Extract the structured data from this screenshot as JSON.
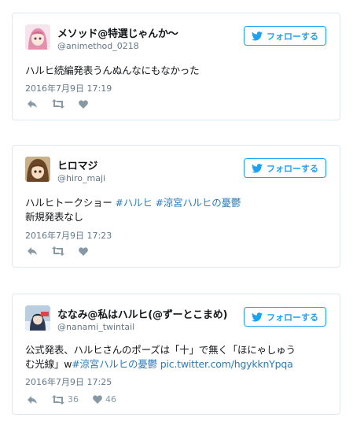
{
  "follow_label": "フォローする",
  "tweets": [
    {
      "name": "メソッド@特選じゃんか〜",
      "handle": "@animethod_0218",
      "text": "ハルヒ続編発表うんぬんなにもなかった",
      "date": "2016年7月9日 17:19"
    },
    {
      "name": "ヒロマジ",
      "handle": "@hiro_maji",
      "text_plain": "ハルヒトークショー ",
      "hashtag1": "#ハルヒ",
      "hashtag2": "#涼宮ハルヒの憂鬱",
      "text_line2": "新規発表なし",
      "date": "2016年7月9日 17:23"
    },
    {
      "name": "ななみ@私はハルヒ(@ずーとこまめ)",
      "handle": "@nanami_twintail",
      "text_line1": "公式発表、ハルヒさんのポーズは「十」で無く「ほにゃしゅう",
      "text_line2_plain": "む光線」w",
      "hashtag": "#涼宮ハルヒの憂鬱",
      "link": "pic.twitter.com/hgykknYpqa",
      "date": "2016年7月9日 17:25",
      "retweets": "36",
      "likes": "46"
    }
  ]
}
